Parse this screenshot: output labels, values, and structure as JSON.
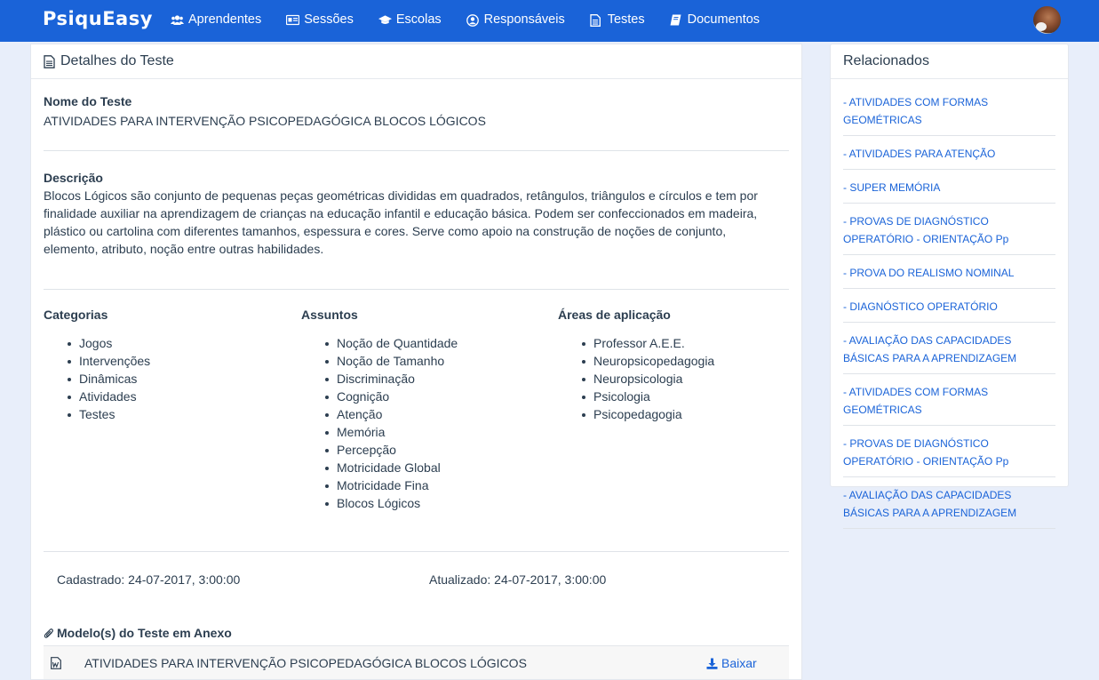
{
  "brand": "PsiquEasy",
  "nav": [
    {
      "label": "Aprendentes",
      "icon": "users-icon"
    },
    {
      "label": "Sessões",
      "icon": "id-card-icon"
    },
    {
      "label": "Escolas",
      "icon": "graduation-cap-icon"
    },
    {
      "label": "Responsáveis",
      "icon": "user-circle-icon"
    },
    {
      "label": "Testes",
      "icon": "file-text-icon"
    },
    {
      "label": "Documentos",
      "icon": "book-icon"
    }
  ],
  "details": {
    "header": "Detalhes do Teste",
    "name_label": "Nome do Teste",
    "name_value": "ATIVIDADES PARA INTERVENÇÃO PSICOPEDAGÓGICA BLOCOS LÓGICOS",
    "desc_label": "Descrição",
    "desc_value": "Blocos Lógicos são conjunto de pequenas peças geométricas divididas em quadrados, retângulos, triângulos e círculos e tem por finalidade auxiliar na aprendizagem de crianças na educação infantil e educação básica. Podem ser confeccionados em madeira, plástico ou cartolina com diferentes tamanhos, espessura e cores. Serve como apoio na construção de noções de conjunto, elemento, atributo, noção entre outras habilidades.",
    "categorias_label": "Categorias",
    "categorias": [
      "Jogos",
      "Intervenções",
      "Dinâmicas",
      "Atividades",
      "Testes"
    ],
    "assuntos_label": "Assuntos",
    "assuntos": [
      "Noção de Quantidade",
      "Noção de Tamanho",
      "Discriminação",
      "Cognição",
      "Atenção",
      "Memória",
      "Percepção",
      "Motricidade Global",
      "Motricidade Fina",
      "Blocos Lógicos"
    ],
    "areas_label": "Áreas de aplicação",
    "areas": [
      "Professor A.E.E.",
      "Neuropsicopedagogia",
      "Neuropsicologia",
      "Psicologia",
      "Psicopedagogia"
    ],
    "cadastrado": "Cadastrado: 24-07-2017, 3:00:00",
    "atualizado": "Atualizado: 24-07-2017, 3:00:00",
    "attach_title": "Modelo(s) do Teste em Anexo",
    "attach_file": "ATIVIDADES PARA INTERVENÇÃO PSICOPEDAGÓGICA BLOCOS LÓGICOS",
    "download_label": "Baixar"
  },
  "related": {
    "header": "Relacionados",
    "items": [
      "- ATIVIDADES COM FORMAS GEOMÉTRICAS",
      "- ATIVIDADES PARA ATENÇÃO",
      "- SUPER MEMÓRIA",
      "- PROVAS DE DIAGNÓSTICO OPERATÓRIO - ORIENTAÇÃO Pp",
      "- PROVA DO REALISMO NOMINAL",
      "- DIAGNÓSTICO OPERATÓRIO",
      "- AVALIAÇÃO DAS CAPACIDADES BÁSICAS PARA A APRENDIZAGEM",
      "- ATIVIDADES COM FORMAS GEOMÉTRICAS",
      "- PROVAS DE DIAGNÓSTICO OPERATÓRIO - ORIENTAÇÃO Pp",
      "- AVALIAÇÃO DAS CAPACIDADES BÁSICAS PARA A APRENDIZAGEM"
    ]
  },
  "colors": {
    "navbar": "#1a63d8",
    "link": "#1a63d8",
    "background": "#e8eefa"
  }
}
